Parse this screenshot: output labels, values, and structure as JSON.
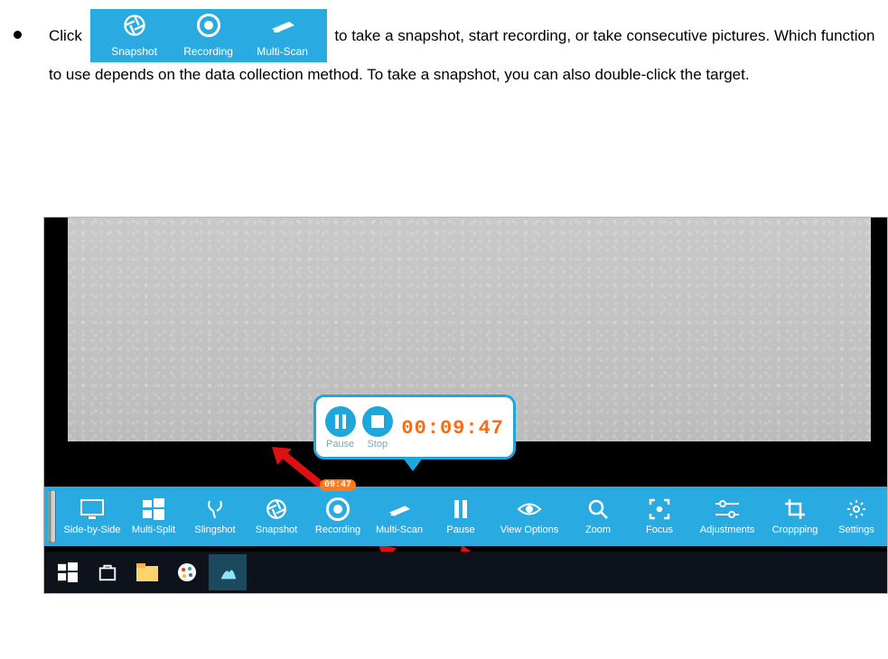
{
  "instruction": {
    "prefix": "Click",
    "suffix": " to take a snapshot, start recording, or take consecutive pictures. Which function to use depends on the data collection method. To take a snapshot, you can also double-click the target."
  },
  "inline_toolbar": {
    "items": [
      {
        "name": "snapshot",
        "label": "Snapshot"
      },
      {
        "name": "recording",
        "label": "Recording"
      },
      {
        "name": "multiscan",
        "label": "Multi-Scan"
      }
    ]
  },
  "popup": {
    "pause_label": "Pause",
    "stop_label": "Stop",
    "time": "00:09:47"
  },
  "recording_badge": "09:47",
  "main_toolbar": {
    "items": [
      {
        "name": "side-by-side",
        "label": "Side-by-Side"
      },
      {
        "name": "multi-split",
        "label": "Multi-Split"
      },
      {
        "name": "slingshot",
        "label": "Slingshot"
      },
      {
        "name": "snapshot",
        "label": "Snapshot"
      },
      {
        "name": "recording",
        "label": "Recording"
      },
      {
        "name": "multi-scan",
        "label": "Multi-Scan"
      },
      {
        "name": "pause",
        "label": "Pause"
      },
      {
        "name": "view-options",
        "label": "View Options"
      },
      {
        "name": "zoom",
        "label": "Zoom"
      },
      {
        "name": "focus",
        "label": "Focus"
      },
      {
        "name": "adjustments",
        "label": "Adjustments"
      },
      {
        "name": "cropping",
        "label": "Croppping"
      },
      {
        "name": "settings",
        "label": "Settings"
      }
    ]
  }
}
